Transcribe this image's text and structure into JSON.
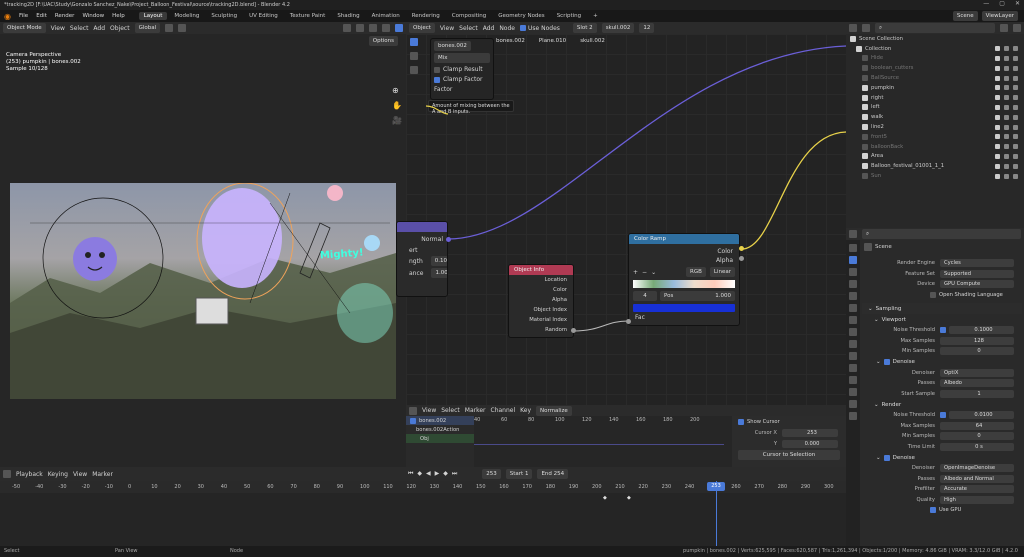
{
  "title": "*tracking2D [F:\\UAC\\Study\\Gonzalo Sanchez_Nake\\Project_Balloon_Festival\\source\\tracking2D.blend] - Blender 4.2",
  "menu": [
    "File",
    "Edit",
    "Render",
    "Window",
    "Help"
  ],
  "workspaces": [
    "Layout",
    "Modeling",
    "Sculpting",
    "UV Editing",
    "Texture Paint",
    "Shading",
    "Animation",
    "Rendering",
    "Compositing",
    "Geometry Nodes",
    "Scripting"
  ],
  "scene_name": "Scene",
  "view_layer": "ViewLayer",
  "viewport": {
    "mode": "Object Mode",
    "menus": [
      "View",
      "Select",
      "Add",
      "Object"
    ],
    "transform": "Global",
    "options": "Options",
    "info": [
      "Camera Perspective",
      "(253) pumpkin | bones.002",
      "Sample 10/128"
    ],
    "overlay_text": "Mighty!"
  },
  "node_editor": {
    "type": "Object",
    "menus": [
      "View",
      "Select",
      "Add",
      "Node"
    ],
    "use_nodes": "Use Nodes",
    "slot": "Slot 2",
    "material": "skull.002",
    "users": "12",
    "breadcrumb": [
      "bones.002",
      "Plane.010",
      "skull.002"
    ],
    "mix_popup": {
      "name": "bones.002",
      "mode": "Mix",
      "clamp_result": "Clamp Result",
      "clamp_factor": "Clamp Factor",
      "factor": "Factor"
    },
    "tooltip": "Amount of mixing between the A and B inputs.",
    "partial_node": {
      "normal": "Normal",
      "strength_label": "ngth",
      "strength": "0.100",
      "distance_label": "ance",
      "distance": "1.000",
      "extra": "ert"
    },
    "object_info": {
      "title": "Object Info",
      "outputs": [
        "Location",
        "Color",
        "Alpha",
        "Object Index",
        "Material Index",
        "Random"
      ]
    },
    "color_ramp": {
      "title": "Color Ramp",
      "outputs": [
        "Color",
        "Alpha"
      ],
      "mode": "RGB",
      "interp": "Linear",
      "index": "4",
      "pos_label": "Pos",
      "pos": "1.000",
      "input": "Fac",
      "ramp_color": "#1730d6"
    }
  },
  "outliner": {
    "search_placeholder": "",
    "items": [
      {
        "name": "Scene Collection",
        "dim": false
      },
      {
        "name": "Collection",
        "dim": false
      },
      {
        "name": "Hide",
        "dim": true
      },
      {
        "name": "boolean_cutters",
        "dim": true
      },
      {
        "name": "BallSource",
        "dim": true
      },
      {
        "name": "pumpkin",
        "dim": false
      },
      {
        "name": "right",
        "dim": false
      },
      {
        "name": "left",
        "dim": false
      },
      {
        "name": "walk",
        "dim": false
      },
      {
        "name": "line2",
        "dim": false
      },
      {
        "name": "front5",
        "dim": true
      },
      {
        "name": "balloonBack",
        "dim": true
      },
      {
        "name": "Area",
        "dim": false
      },
      {
        "name": "Balloon_festival_01001_1_1",
        "dim": false
      },
      {
        "name": "Sun",
        "dim": true
      }
    ]
  },
  "properties": {
    "scene": "Scene",
    "render_engine_label": "Render Engine",
    "render_engine": "Cycles",
    "feature_set_label": "Feature Set",
    "feature_set": "Supported",
    "device_label": "Device",
    "device": "GPU Compute",
    "osl": "Open Shading Language",
    "sampling": "Sampling",
    "viewport_sec": "Viewport",
    "noise_threshold_label": "Noise Threshold",
    "vp_noise": "0.1000",
    "max_samples_label": "Max Samples",
    "vp_max": "128",
    "min_samples_label": "Min Samples",
    "vp_min": "0",
    "denoise": "Denoise",
    "denoiser_label": "Denoiser",
    "vp_denoiser": "OptiX",
    "passes_label": "Passes",
    "vp_passes": "Albedo",
    "start_sample_label": "Start Sample",
    "vp_start": "1",
    "render_sec": "Render",
    "r_noise": "0.0100",
    "r_max": "64",
    "r_min": "0",
    "time_limit_label": "Time Limit",
    "r_time": "0 s",
    "r_denoiser": "OpenImageDenoise",
    "r_passes": "Albedo and Normal",
    "prefilter_label": "Prefilter",
    "r_prefilter": "Accurate",
    "quality_label": "Quality",
    "r_quality": "High",
    "use_gpu": "Use GPU"
  },
  "graph_editor": {
    "menus": [
      "View",
      "Select",
      "Marker",
      "Channel",
      "Key"
    ],
    "normalize": "Normalize",
    "channels": [
      "bones.002",
      "bones.002Action",
      "Obj"
    ],
    "ticks": [
      "40",
      "60",
      "80",
      "100",
      "120",
      "140",
      "160",
      "180",
      "200"
    ],
    "show_cursor": "Show Cursor",
    "cursor_x_label": "Cursor X",
    "cursor_x": "253",
    "cursor_y_label": "Y",
    "cursor_y": "0.000",
    "cursor_to_selection": "Cursor to Selection",
    "cursor_value": "Cursor Value to Selection"
  },
  "timeline": {
    "menus": [
      "Playback",
      "Keying",
      "View",
      "Marker"
    ],
    "current_frame": "253",
    "start_label": "Start",
    "start": "1",
    "end_label": "End",
    "end": "254",
    "ticks": [
      "-50",
      "-40",
      "-30",
      "-20",
      "-10",
      "0",
      "10",
      "20",
      "30",
      "40",
      "50",
      "60",
      "70",
      "80",
      "90",
      "100",
      "110",
      "120",
      "130",
      "140",
      "150",
      "160",
      "170",
      "180",
      "190",
      "200",
      "210",
      "220",
      "230",
      "240",
      "250",
      "260",
      "270",
      "280",
      "290",
      "300"
    ]
  },
  "statusbar": {
    "select": "Select",
    "pan": "Pan View",
    "node": "Node",
    "stats": "pumpkin | bones.002 | Verts:625,595 | Faces:620,587 | Tris:1,261,394 | Objects:1/200 | Memory: 4.86 GiB | VRAM: 3.3/12.0 GiB | 4.2.0"
  },
  "colors": {
    "accent": "#4a7ad8",
    "object_node": "#b03a53",
    "ramp_node": "#2f6fa0",
    "wire_purple": "#6b5fd8",
    "wire_yellow": "#e8d24a"
  }
}
